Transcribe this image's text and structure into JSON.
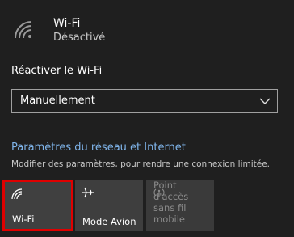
{
  "wifi": {
    "title": "Wi-Fi",
    "status": "Désactivé",
    "icon": "wifi-icon"
  },
  "reactivate": {
    "label": "Réactiver le Wi-Fi",
    "dropdown_value": "Manuellement"
  },
  "network_settings": {
    "link_label": "Paramètres du réseau et Internet",
    "description": "Modifier des paramètres, pour rendre une connexion limitée."
  },
  "tiles": [
    {
      "label": "Wi-Fi",
      "icon": "wifi-icon"
    },
    {
      "label": "Mode Avion",
      "icon": "airplane-icon"
    },
    {
      "label_line1": "Point d'accès",
      "label_line2": "sans fil mobile",
      "icon": "hotspot-icon"
    }
  ],
  "colors": {
    "background": "#1f1f1f",
    "link": "#7fb4ea",
    "highlight_border": "#e00000",
    "tile": "#3e3e3e"
  }
}
